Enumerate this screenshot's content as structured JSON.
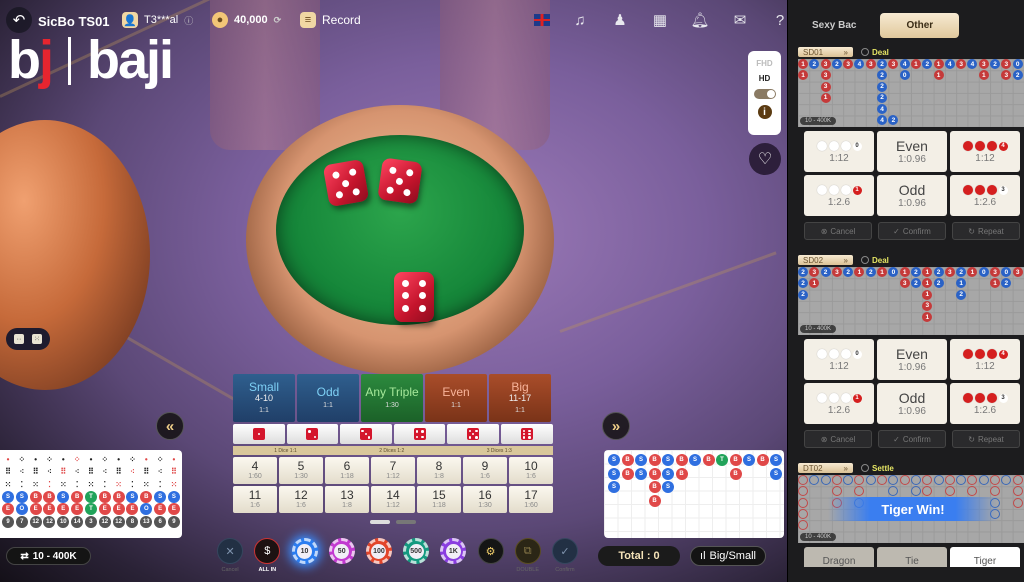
{
  "header": {
    "title": "SicBo TS01",
    "username": "T3***al",
    "balance": "40,000",
    "record_label": "Record",
    "logo_left": "bj",
    "logo_right": "baji",
    "icons": [
      "flag-uk-icon",
      "music-icon",
      "dealer-settings-icon",
      "multi-table-icon",
      "notification-bell-icon",
      "mail-icon",
      "help-icon",
      "power-icon"
    ]
  },
  "video_quality": {
    "options": [
      "FHD",
      "HD"
    ],
    "selected": "HD",
    "toggle_label": "ON"
  },
  "main_bets": [
    {
      "label": "Small",
      "range": "4-10",
      "odds": "1:1",
      "color": "blue"
    },
    {
      "label": "Odd",
      "range": "",
      "odds": "1:1",
      "color": "blue"
    },
    {
      "label": "Any Triple",
      "range": "",
      "odds": "1:30",
      "color": "green"
    },
    {
      "label": "Even",
      "range": "",
      "odds": "1:1",
      "color": "red"
    },
    {
      "label": "Big",
      "range": "11-17",
      "odds": "1:1",
      "color": "red"
    }
  ],
  "single_dice": [
    1,
    2,
    3,
    4,
    5,
    6
  ],
  "dice_labels": [
    "1 Dice 1:1",
    "2 Dices 1:2",
    "3 Dices 1:3"
  ],
  "sum_bets": [
    {
      "sum": "4",
      "odds": "1:60"
    },
    {
      "sum": "5",
      "odds": "1:30"
    },
    {
      "sum": "6",
      "odds": "1:18"
    },
    {
      "sum": "7",
      "odds": "1:12"
    },
    {
      "sum": "8",
      "odds": "1:8"
    },
    {
      "sum": "9",
      "odds": "1:6"
    },
    {
      "sum": "10",
      "odds": "1:6"
    },
    {
      "sum": "11",
      "odds": "1:6"
    },
    {
      "sum": "12",
      "odds": "1:6"
    },
    {
      "sum": "13",
      "odds": "1:8"
    },
    {
      "sum": "14",
      "odds": "1:12"
    },
    {
      "sum": "15",
      "odds": "1:18"
    },
    {
      "sum": "16",
      "odds": "1:30"
    },
    {
      "sum": "17",
      "odds": "1:60"
    }
  ],
  "history_left": {
    "bigsmall": [
      "S",
      "S",
      "B",
      "B",
      "S",
      "B",
      "T",
      "B",
      "B",
      "S",
      "B",
      "S",
      "S"
    ],
    "oddeven": [
      "E",
      "O",
      "E",
      "E",
      "E",
      "E",
      "T",
      "E",
      "E",
      "E",
      "O",
      "E",
      "E"
    ],
    "totals": [
      "9",
      "7",
      "12",
      "12",
      "10",
      "14",
      "3",
      "12",
      "12",
      "8",
      "13",
      "6",
      "9"
    ]
  },
  "limit_label": "10 - 400K",
  "history_right": [
    [
      "S",
      "S",
      "S"
    ],
    [
      "B",
      "B"
    ],
    [
      "S",
      "S"
    ],
    [
      "B",
      "B",
      "B",
      "B"
    ],
    [
      "S",
      "S",
      "S"
    ],
    [
      "B",
      "B"
    ],
    [
      "S"
    ],
    [
      "B"
    ],
    [
      "T"
    ],
    [
      "B",
      "B"
    ],
    [
      "S"
    ],
    [
      "B"
    ],
    [
      "S",
      "S"
    ]
  ],
  "total_label": "Total : 0",
  "bigsmall_button": "Big/Small",
  "chips": [
    {
      "name": "cancel",
      "label": "Cancel",
      "value": ""
    },
    {
      "name": "all-in",
      "label": "ALL IN",
      "value": ""
    },
    {
      "name": "chip-10",
      "label": "",
      "value": "10",
      "color": "#2b7df0"
    },
    {
      "name": "chip-50",
      "label": "",
      "value": "50",
      "color": "#c23ad0"
    },
    {
      "name": "chip-100",
      "label": "",
      "value": "100",
      "color": "#e2452a"
    },
    {
      "name": "chip-500",
      "label": "",
      "value": "500",
      "color": "#149a80"
    },
    {
      "name": "chip-1k",
      "label": "",
      "value": "1K",
      "color": "#8a3ee0"
    },
    {
      "name": "settings",
      "label": "",
      "value": ""
    },
    {
      "name": "double",
      "label": "DOUBLE",
      "value": ""
    },
    {
      "name": "confirm",
      "label": "Confirm",
      "value": ""
    }
  ],
  "panel": {
    "tabs": [
      "Sexy Bac",
      "Other"
    ],
    "active_tab": "Other",
    "tables": [
      {
        "id": "SD01",
        "status": "Deal",
        "limit": "10 - 400K",
        "road": [
          [
            "r1",
            "r1"
          ],
          [
            "b2"
          ],
          [
            "r3",
            "r3",
            "r3",
            "r1"
          ],
          [
            "b2"
          ],
          [
            "r3"
          ],
          [
            "b4"
          ],
          [
            "r3"
          ],
          [
            "b2",
            "b2",
            "b2",
            "b2",
            "b4",
            "b4"
          ],
          [
            "r3",
            "",
            "",
            "",
            "",
            "b2"
          ],
          [
            "b4",
            "b0"
          ],
          [
            "r1"
          ],
          [
            "b2"
          ],
          [
            "r1",
            "r1"
          ],
          [
            "b4"
          ],
          [
            "r3"
          ],
          [
            "b4"
          ],
          [
            "r3",
            "r1"
          ],
          [
            "b2"
          ],
          [
            "r3",
            "r3"
          ],
          [
            "b0",
            "b2"
          ]
        ],
        "bets": [
          {
            "type": "dots",
            "white": 3,
            "red": 0,
            "badge": "0",
            "odds": "1:12"
          },
          {
            "type": "text",
            "label": "Even",
            "odds": "1:0.96"
          },
          {
            "type": "dots",
            "white": 0,
            "red": 3,
            "badge": "4",
            "badge_red": true,
            "odds": "1:12"
          },
          {
            "type": "dots",
            "white": 3,
            "red": 0,
            "badge": "1",
            "badge_red": true,
            "odds": "1:2.6"
          },
          {
            "type": "text",
            "label": "Odd",
            "odds": "1:0.96"
          },
          {
            "type": "dots",
            "white": 0,
            "red": 3,
            "badge": "3",
            "odds": "1:2.6"
          }
        ],
        "actions": [
          "Cancel",
          "Confirm",
          "Repeat"
        ]
      },
      {
        "id": "SD02",
        "status": "Deal",
        "limit": "10 - 400K",
        "road": [
          [
            "b2",
            "b2",
            "b2"
          ],
          [
            "r3",
            "r1"
          ],
          [
            "b2"
          ],
          [
            "r3"
          ],
          [
            "b2"
          ],
          [
            "r1"
          ],
          [
            "b2"
          ],
          [
            "r1"
          ],
          [
            "b0"
          ],
          [
            "r1",
            "r3"
          ],
          [
            "b2",
            "b2"
          ],
          [
            "r1",
            "r1",
            "r1",
            "r3",
            "r1"
          ],
          [
            "b2",
            "b2"
          ],
          [
            "r3"
          ],
          [
            "b2",
            "b1",
            "b2"
          ],
          [
            "r1"
          ],
          [
            "b0"
          ],
          [
            "r3",
            "r1"
          ],
          [
            "b0",
            "b2"
          ],
          [
            "r3"
          ]
        ],
        "bets": [
          {
            "type": "dots",
            "white": 3,
            "red": 0,
            "badge": "0",
            "odds": "1:12"
          },
          {
            "type": "text",
            "label": "Even",
            "odds": "1:0.96"
          },
          {
            "type": "dots",
            "white": 0,
            "red": 3,
            "badge": "4",
            "badge_red": true,
            "odds": "1:12"
          },
          {
            "type": "dots",
            "white": 3,
            "red": 0,
            "badge": "1",
            "badge_red": true,
            "odds": "1:2.6"
          },
          {
            "type": "text",
            "label": "Odd",
            "odds": "1:0.96"
          },
          {
            "type": "dots",
            "white": 0,
            "red": 3,
            "badge": "3",
            "odds": "1:2.6"
          }
        ],
        "actions": [
          "Cancel",
          "Confirm",
          "Repeat"
        ]
      },
      {
        "id": "DT02",
        "status": "Settle",
        "limit": "10 - 400K",
        "banner": "Tiger Win!",
        "road": [
          [
            "ro",
            "ro",
            "ro",
            "ro",
            "ro"
          ],
          [
            "bo"
          ],
          [
            "bo"
          ],
          [
            "ro",
            "ro",
            "ro"
          ],
          [
            "bo"
          ],
          [
            "ro",
            "ro",
            "bo"
          ],
          [
            "bo"
          ],
          [
            "ro"
          ],
          [
            "bo",
            "bo",
            "bo"
          ],
          [
            "ro"
          ],
          [
            "bo",
            "bo"
          ],
          [
            "ro",
            "ro"
          ],
          [
            "bo"
          ],
          [
            "ro",
            "ro"
          ],
          [
            "bo"
          ],
          [
            "ro",
            "ro"
          ],
          [
            "bo"
          ],
          [
            "ro",
            "ro",
            "bo",
            "bo"
          ],
          [
            "bo"
          ],
          [
            "ro",
            "ro",
            "ro"
          ]
        ],
        "bets": [
          "Dragon",
          "Tie",
          "Tiger"
        ],
        "selected_bet": "Tiger"
      }
    ]
  }
}
